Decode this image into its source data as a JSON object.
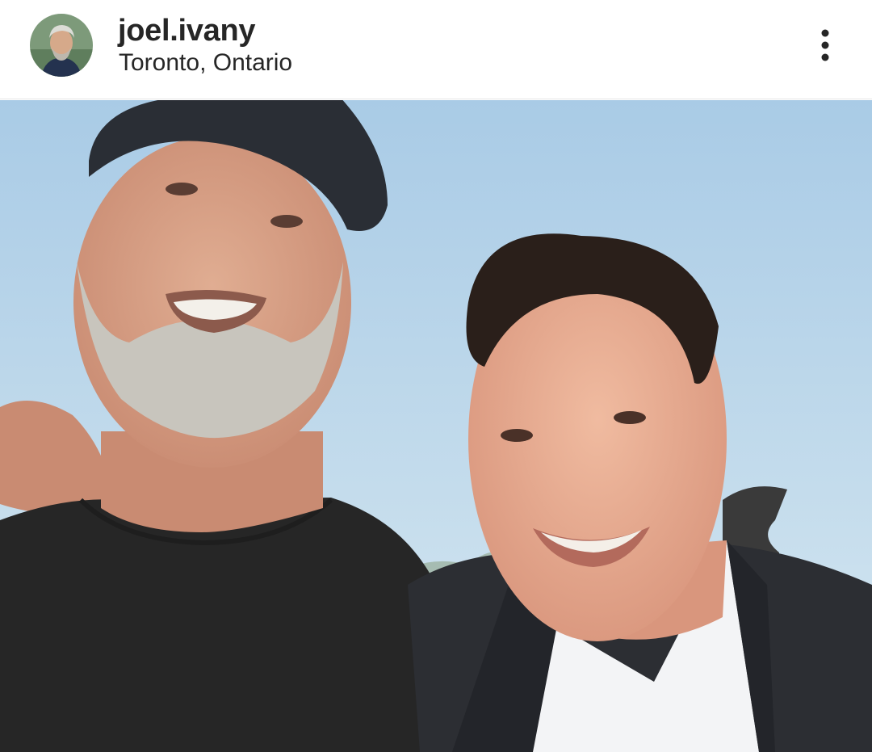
{
  "post_header": {
    "username": "joel.ivany",
    "location": "Toronto, Ontario",
    "avatar_icon": "profile-avatar",
    "more_icon": "more-vertical-icon"
  },
  "post_photo": {
    "icon": "selfie-photo"
  },
  "colors": {
    "text": "#262626",
    "sky_top": "#a9cbe6",
    "sky_bottom": "#d7e8f2"
  }
}
